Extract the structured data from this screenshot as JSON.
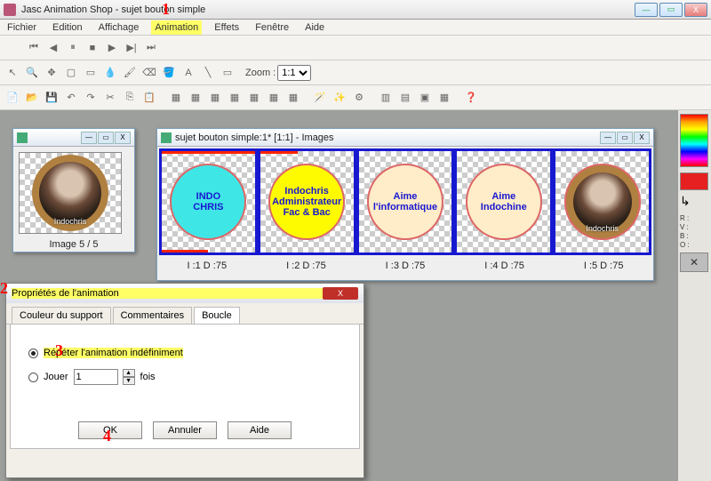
{
  "app": {
    "title": "Jasc Animation Shop - sujet bouton simple"
  },
  "window_buttons": {
    "min": "—",
    "max": "▭",
    "close": "X"
  },
  "menu": [
    "Fichier",
    "Edition",
    "Affichage",
    "Animation",
    "Effets",
    "Fenêtre",
    "Aide"
  ],
  "menu_highlight_index": 3,
  "zoom": {
    "label": "Zoom :",
    "value": "1:1"
  },
  "preview": {
    "caption": "Image 5 / 5",
    "avatar_name": "Indochris"
  },
  "frames_window": {
    "title": "sujet bouton simple:1* [1:1] - Images"
  },
  "frames": [
    {
      "lines": [
        "INDO",
        "CHRIS"
      ],
      "caption": "I :1  D :75",
      "style": "cyan"
    },
    {
      "lines": [
        "Indochris",
        "Administrateur",
        "Fac & Bac"
      ],
      "caption": "I :2  D :75",
      "style": "yellow"
    },
    {
      "lines": [
        "Aime",
        "l'informatique"
      ],
      "caption": "I :3  D :75",
      "style": "cream"
    },
    {
      "lines": [
        "Aime",
        "Indochine"
      ],
      "caption": "I :4  D :75",
      "style": "cream"
    },
    {
      "lines": [
        "Indochris"
      ],
      "caption": "I :5  D :75",
      "style": "brown"
    }
  ],
  "dialog": {
    "title": "Propriétés de l'animation",
    "tabs": [
      "Couleur du support",
      "Commentaires",
      "Boucle"
    ],
    "active_tab": 2,
    "radio_repeat": "Répéter l'animation indéfiniment",
    "radio_play": "Jouer",
    "play_count": "1",
    "play_suffix": "fois",
    "buttons": {
      "ok": "OK",
      "cancel": "Annuler",
      "help": "Aide"
    }
  },
  "palette": {
    "labels": [
      "R :",
      "V :",
      "B :",
      "O :"
    ]
  },
  "annotations": {
    "a1": "1",
    "a2": "2",
    "a3": "3",
    "a4": "4"
  }
}
